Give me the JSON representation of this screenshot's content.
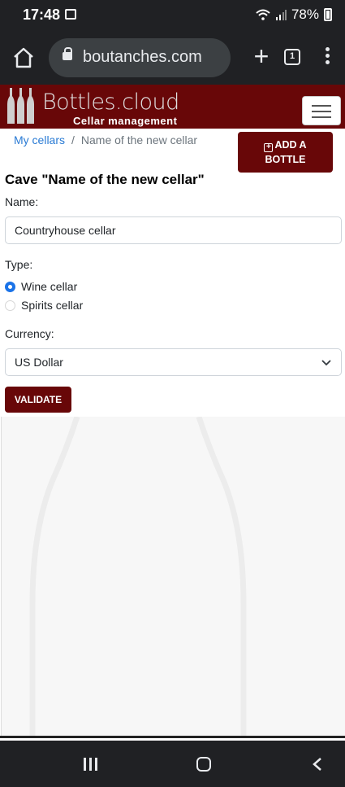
{
  "status_bar": {
    "time": "17:48",
    "battery": "78%"
  },
  "browser": {
    "url": "boutanches.com",
    "tab_count": "1"
  },
  "site": {
    "logo_text": "Bottles.cloud",
    "logo_subtitle": "Cellar management"
  },
  "breadcrumb": {
    "root": "My cellars",
    "separator": "/",
    "current": "Name of the new cellar"
  },
  "add_bottle_button": {
    "line1": "ADD A",
    "line2": "BOTTLE"
  },
  "page_title": "Cave \"Name of the new cellar\"",
  "form": {
    "name_label": "Name:",
    "name_value": "Countryhouse cellar",
    "type_label": "Type:",
    "type_options": [
      {
        "label": "Wine cellar",
        "checked": true
      },
      {
        "label": "Spirits cellar",
        "checked": false
      }
    ],
    "currency_label": "Currency:",
    "currency_value": "US Dollar",
    "validate_label": "VALIDATE"
  },
  "colors": {
    "brand": "#680708",
    "link": "#2a7bd4",
    "radio_accent": "#1a73e8",
    "chrome_dark": "#202124"
  }
}
